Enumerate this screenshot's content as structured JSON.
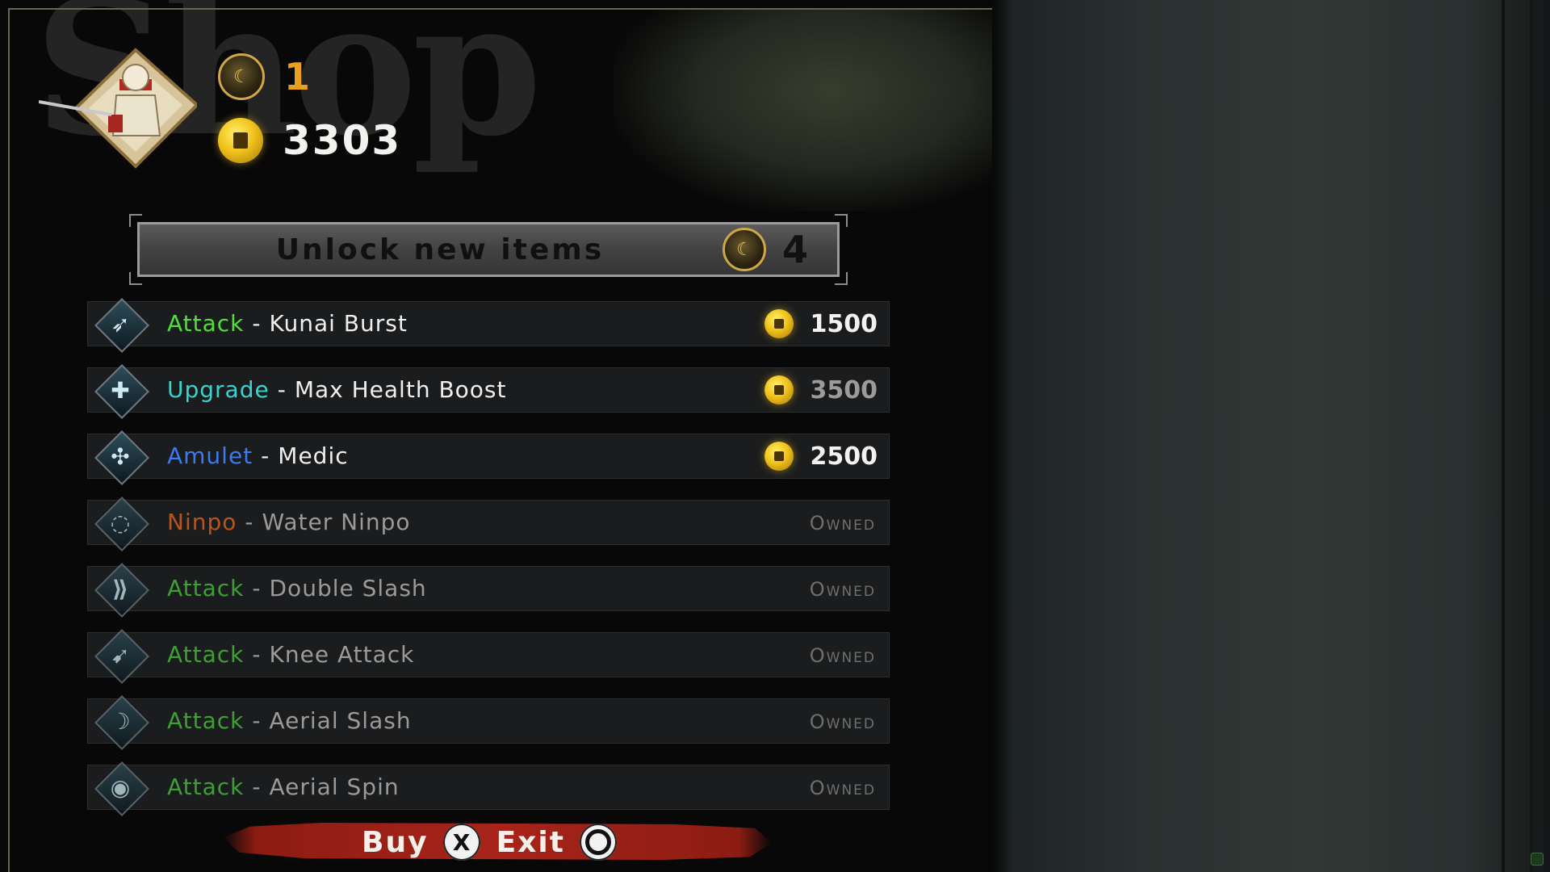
{
  "background_title": "Shop",
  "currencies": {
    "moon_tokens": "1",
    "coins": "3303"
  },
  "unlock": {
    "label": "Unlock new items",
    "cost": "4"
  },
  "items": [
    {
      "category": "Attack",
      "category_color": "#4fe03a",
      "name": "Kunai Burst",
      "price": "1500",
      "price_dim": false,
      "owned": false,
      "icon": "kunai-burst-icon"
    },
    {
      "category": "Upgrade",
      "category_color": "#36d4d0",
      "name": "Max Health Boost",
      "price": "3500",
      "price_dim": true,
      "owned": false,
      "icon": "health-cross-icon"
    },
    {
      "category": "Amulet",
      "category_color": "#3b7af0",
      "name": "Medic",
      "price": "2500",
      "price_dim": false,
      "owned": false,
      "icon": "medic-amulet-icon"
    },
    {
      "category": "Ninpo",
      "category_color": "#b5561c",
      "name": "Water Ninpo",
      "status": "Owned",
      "owned": true,
      "icon": "water-ninpo-icon"
    },
    {
      "category": "Attack",
      "category_color": "#3ea034",
      "name": "Double Slash",
      "status": "Owned",
      "owned": true,
      "icon": "double-slash-icon"
    },
    {
      "category": "Attack",
      "category_color": "#3ea034",
      "name": "Knee Attack",
      "status": "Owned",
      "owned": true,
      "icon": "knee-attack-icon"
    },
    {
      "category": "Attack",
      "category_color": "#3ea034",
      "name": "Aerial Slash",
      "status": "Owned",
      "owned": true,
      "icon": "aerial-slash-icon"
    },
    {
      "category": "Attack",
      "category_color": "#3ea034",
      "name": "Aerial Spin",
      "status": "Owned",
      "owned": true,
      "icon": "aerial-spin-icon"
    }
  ],
  "footer": {
    "buy_label": "Buy",
    "buy_button": "X",
    "exit_label": "Exit"
  },
  "colors": {
    "coin_gold": "#f0c21b",
    "moon_amount": "#e9a01c",
    "footer_red": "#a8241a"
  }
}
